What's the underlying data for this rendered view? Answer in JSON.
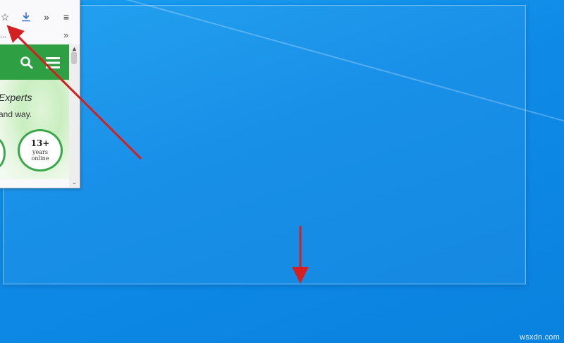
{
  "browser": {
    "bookmarks_bar_text": "...",
    "icons": {
      "bookmark": "star-icon",
      "downloads": "download-icon",
      "overflow": "chevrons-right-icon",
      "menu": "hamburger-menu-icon"
    }
  },
  "page": {
    "header_color": "#2ea043",
    "hero_heading": "Experts",
    "hero_subtext": "and way.",
    "badge": {
      "number": "13+",
      "line1": "years",
      "line2": "online"
    }
  },
  "annotations": {
    "arrow_color": "#d42020"
  },
  "watermark": "wsxdn.com"
}
